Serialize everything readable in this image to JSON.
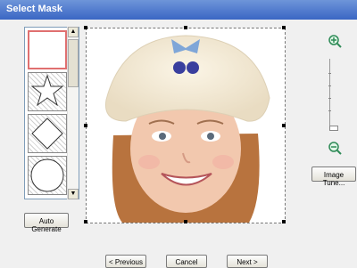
{
  "window": {
    "title": "Select Mask"
  },
  "mask_list": {
    "items": [
      {
        "shape": "rectangle",
        "selected": true
      },
      {
        "shape": "star",
        "selected": false
      },
      {
        "shape": "diamond",
        "selected": false
      },
      {
        "shape": "circle",
        "selected": false
      }
    ]
  },
  "buttons": {
    "auto_generate": "Auto Generate",
    "image_tune": "Image Tune...",
    "previous": "< Previous",
    "cancel": "Cancel",
    "next": "Next >"
  },
  "icons": {
    "zoom_in": "zoom-in-icon",
    "zoom_out": "zoom-out-icon",
    "scroll_up": "scroll-up-icon",
    "scroll_down": "scroll-down-icon"
  },
  "colors": {
    "titlebar": "#3A66C4",
    "selection_border": "#E07070",
    "zoom_icon": "#2E8B57"
  }
}
